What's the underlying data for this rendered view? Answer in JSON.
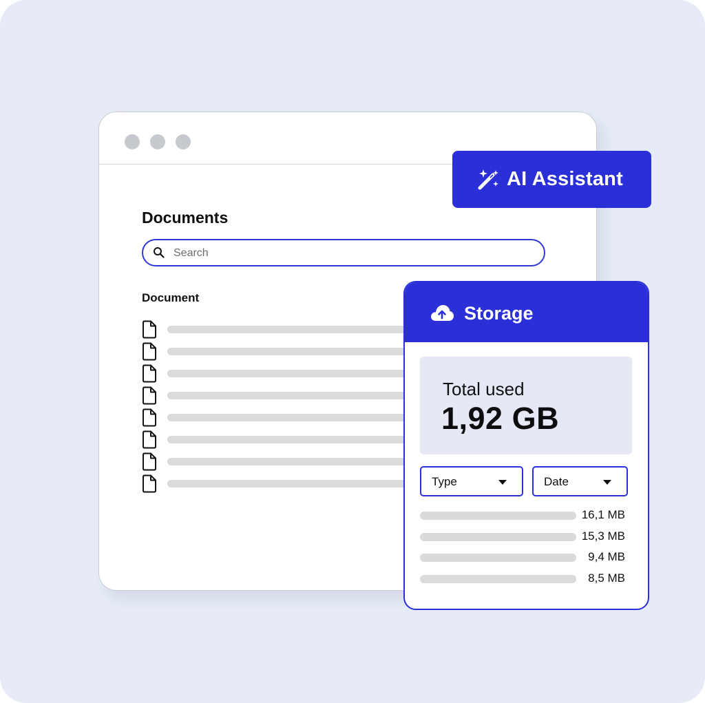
{
  "documents": {
    "title": "Documents",
    "search": {
      "placeholder": "Search",
      "value": ""
    },
    "column_header": "Document",
    "rows": [
      {
        "icon": "document-icon"
      },
      {
        "icon": "document-icon"
      },
      {
        "icon": "document-icon"
      },
      {
        "icon": "document-icon"
      },
      {
        "icon": "document-icon"
      },
      {
        "icon": "document-icon"
      },
      {
        "icon": "document-icon"
      },
      {
        "icon": "document-icon"
      }
    ]
  },
  "ai_assistant": {
    "label": "AI Assistant",
    "icon": "magic-wand-icon"
  },
  "storage": {
    "title": "Storage",
    "icon": "cloud-upload-icon",
    "total_label": "Total used",
    "total_value": "1,92 GB",
    "filters": [
      {
        "label": "Type"
      },
      {
        "label": "Date"
      }
    ],
    "files": [
      {
        "size": "16,1 MB"
      },
      {
        "size": "15,3 MB"
      },
      {
        "size": "9,4 MB"
      },
      {
        "size": "8,5 MB"
      }
    ]
  },
  "colors": {
    "accent": "#2a2fd8",
    "background": "#e6ebf7",
    "placeholder_bar": "#dadadd"
  }
}
